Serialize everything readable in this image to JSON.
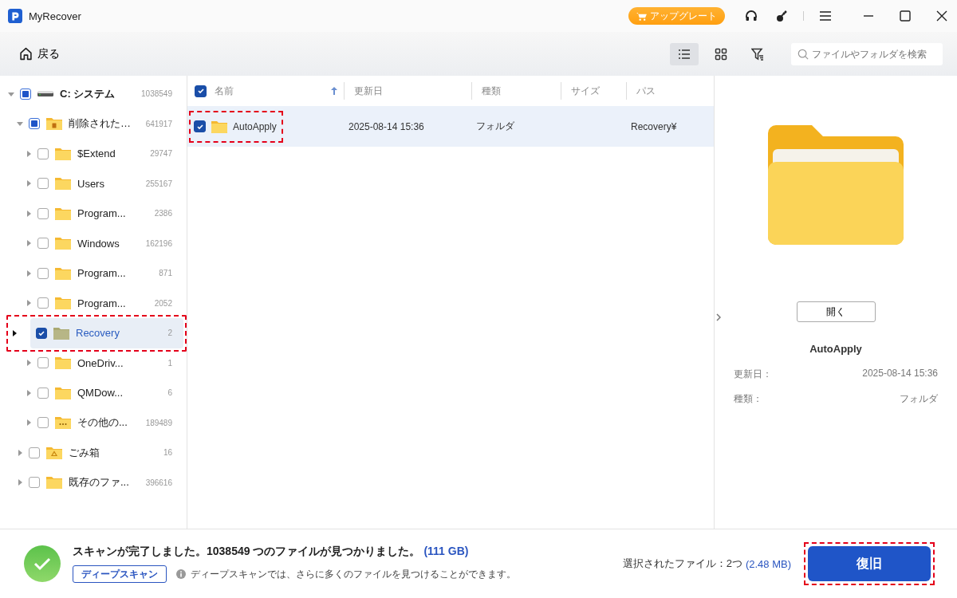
{
  "window": {
    "title": "MyRecover",
    "upgrade": "アップグレート"
  },
  "toolbar": {
    "back": "戻る",
    "views": [
      {
        "kind": "list",
        "selected": true
      },
      {
        "kind": "grid",
        "selected": false
      },
      {
        "kind": "filter",
        "selected": false
      }
    ],
    "search": {
      "placeholder": "ファイルやフォルダを検索"
    }
  },
  "tree": [
    {
      "label": "C: システム",
      "count": "1038549",
      "kind": "drive",
      "checked": false,
      "partial": true,
      "expanded": true,
      "selected": false,
      "highlighted": false,
      "children": [
        {
          "label": "削除された…",
          "count": "641917",
          "kind": "trash",
          "checked": false,
          "partial": true,
          "expanded": true,
          "selected": false,
          "highlighted": false,
          "children": [
            {
              "label": "$Extend",
              "count": "29747",
              "kind": "folder",
              "checked": false,
              "partial": false,
              "expanded": false,
              "selected": false,
              "highlighted": false
            },
            {
              "label": "Users",
              "count": "255167",
              "kind": "folder",
              "checked": false,
              "partial": false,
              "expanded": false,
              "selected": false,
              "highlighted": false
            },
            {
              "label": "Program...",
              "count": "2386",
              "kind": "folder",
              "checked": false,
              "partial": false,
              "expanded": false,
              "selected": false,
              "highlighted": false
            },
            {
              "label": "Windows",
              "count": "162196",
              "kind": "folder",
              "checked": false,
              "partial": false,
              "expanded": false,
              "selected": false,
              "highlighted": false
            },
            {
              "label": "Program...",
              "count": "871",
              "kind": "folder",
              "checked": false,
              "partial": false,
              "expanded": false,
              "selected": false,
              "highlighted": false
            },
            {
              "label": "Program...",
              "count": "2052",
              "kind": "folder",
              "checked": false,
              "partial": false,
              "expanded": false,
              "selected": false,
              "highlighted": false
            },
            {
              "label": "Recovery",
              "count": "2",
              "kind": "folder",
              "checked": true,
              "partial": false,
              "expanded": false,
              "selected": true,
              "highlighted": true
            },
            {
              "label": "OneDriv...",
              "count": "1",
              "kind": "folder",
              "checked": false,
              "partial": false,
              "expanded": false,
              "selected": false,
              "highlighted": false
            },
            {
              "label": "QMDow...",
              "count": "6",
              "kind": "folder",
              "checked": false,
              "partial": false,
              "expanded": false,
              "selected": false,
              "highlighted": false
            },
            {
              "label": "その他の...",
              "count": "189489",
              "kind": "more",
              "checked": false,
              "partial": false,
              "expanded": false,
              "selected": false,
              "highlighted": false
            }
          ]
        },
        {
          "label": "ごみ箱",
          "count": "16",
          "kind": "recycle",
          "checked": false,
          "partial": false,
          "expanded": false,
          "selected": false,
          "highlighted": false
        },
        {
          "label": "既存のファ...",
          "count": "396616",
          "kind": "folder",
          "checked": false,
          "partial": false,
          "expanded": false,
          "selected": false,
          "highlighted": false
        }
      ]
    }
  ],
  "table": {
    "all_checked": true,
    "columns": [
      {
        "label": "名前",
        "sorted": true
      },
      {
        "label": "更新日",
        "sorted": false
      },
      {
        "label": "種類",
        "sorted": false
      },
      {
        "label": "サイズ",
        "sorted": false
      },
      {
        "label": "パス",
        "sorted": false
      }
    ],
    "rows": [
      {
        "name": "AutoApply",
        "modified": "2025-08-14 15:36",
        "type": "フォルダ",
        "path": "Recovery¥",
        "checked": true,
        "selected": true,
        "highlighted": true
      }
    ]
  },
  "preview": {
    "open": "開く",
    "name": "AutoApply",
    "details": [
      {
        "label": "更新日：",
        "value": "2025-08-14 15:36"
      },
      {
        "label": "種類：",
        "value": "フォルダ"
      }
    ]
  },
  "footer": {
    "status": "スキャンが完了しました。1038549 つのファイルが見つかりました。",
    "status_size": "(111 GB)",
    "deep_scan": "ディープスキャン",
    "hint": "ディープスキャンでは、さらに多くのファイルを見つけることができます。",
    "selected_label": "選択されたファイル：2つ",
    "selected_size": "(2.48 MB)",
    "recover": "復旧",
    "recover_highlighted": true
  }
}
